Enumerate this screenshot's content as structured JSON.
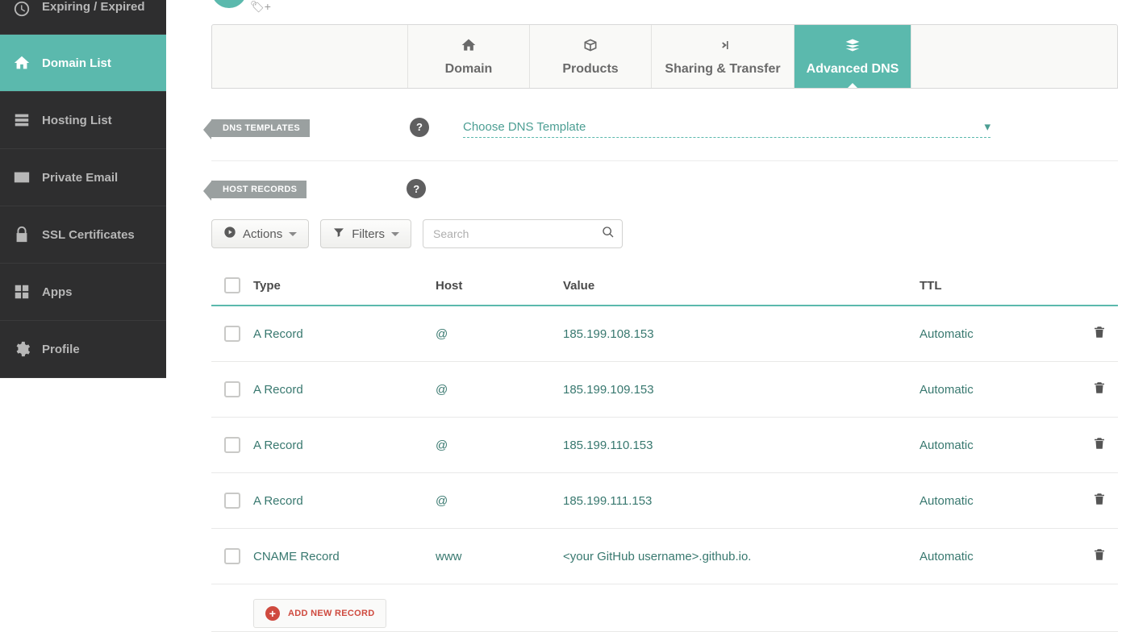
{
  "sidebar": {
    "items": [
      {
        "label": "Expiring / Expired"
      },
      {
        "label": "Domain List"
      },
      {
        "label": "Hosting List"
      },
      {
        "label": "Private Email"
      },
      {
        "label": "SSL Certificates"
      },
      {
        "label": "Apps"
      },
      {
        "label": "Profile"
      }
    ]
  },
  "tabs": {
    "domain": "Domain",
    "products": "Products",
    "sharing": "Sharing & Transfer",
    "advanced": "Advanced DNS"
  },
  "sections": {
    "dns_templates": "DNS TEMPLATES",
    "host_records": "HOST RECORDS",
    "template_placeholder": "Choose DNS Template"
  },
  "toolbar": {
    "actions": "Actions",
    "filters": "Filters",
    "search_placeholder": "Search"
  },
  "table": {
    "headers": {
      "type": "Type",
      "host": "Host",
      "value": "Value",
      "ttl": "TTL"
    },
    "rows": [
      {
        "type": "A Record",
        "host": "@",
        "value": "185.199.108.153",
        "ttl": "Automatic"
      },
      {
        "type": "A Record",
        "host": "@",
        "value": "185.199.109.153",
        "ttl": "Automatic"
      },
      {
        "type": "A Record",
        "host": "@",
        "value": "185.199.110.153",
        "ttl": "Automatic"
      },
      {
        "type": "A Record",
        "host": "@",
        "value": "185.199.111.153",
        "ttl": "Automatic"
      },
      {
        "type": "CNAME Record",
        "host": "www",
        "value": "<your GitHub username>.github.io.",
        "ttl": "Automatic"
      }
    ]
  },
  "add_record": "ADD NEW RECORD",
  "help": "?"
}
